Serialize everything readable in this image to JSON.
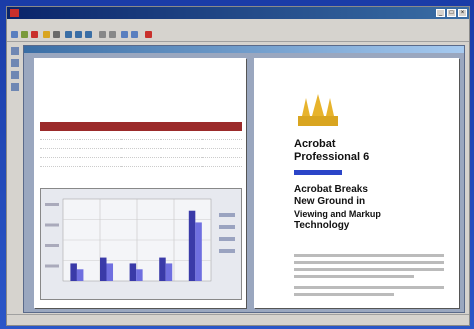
{
  "window": {
    "title": "",
    "controls": [
      "_",
      "□",
      "×"
    ]
  },
  "menu": [
    "",
    "",
    "",
    "",
    "",
    "",
    ""
  ],
  "document": {
    "left": {
      "title": "",
      "subtitle": "",
      "table": {
        "headers": [
          "",
          "",
          "",
          "",
          ""
        ],
        "rows": [
          [
            "",
            "",
            "",
            "",
            ""
          ],
          [
            "",
            "",
            "",
            "",
            ""
          ],
          [
            "",
            "",
            "",
            "",
            ""
          ],
          [
            "",
            "",
            "",
            "",
            ""
          ]
        ]
      }
    },
    "right": {
      "heading_line1": "Acrobat",
      "heading_line2": "Professional 6",
      "feature_line1": "Acrobat Breaks",
      "feature_line2": "New Ground in",
      "feature_line3": "Viewing and Markup",
      "feature_line4": "Technology",
      "small_line1": "",
      "small_line2": ""
    }
  },
  "status": {
    "left": "",
    "mid": "",
    "right": ""
  },
  "colors": {
    "bar_a": "#3a3aa8",
    "bar_b": "#6f6fe0",
    "table_header": "#9b2a2a",
    "accent_blue": "#2b45c8"
  },
  "chart_data": {
    "type": "bar",
    "categories": [
      "",
      "",
      "",
      "",
      ""
    ],
    "series": [
      {
        "values": [
          3,
          4,
          3,
          4,
          12
        ]
      },
      {
        "values": [
          2,
          3,
          2,
          3,
          10
        ]
      }
    ],
    "ylim": [
      0,
      14
    ]
  }
}
